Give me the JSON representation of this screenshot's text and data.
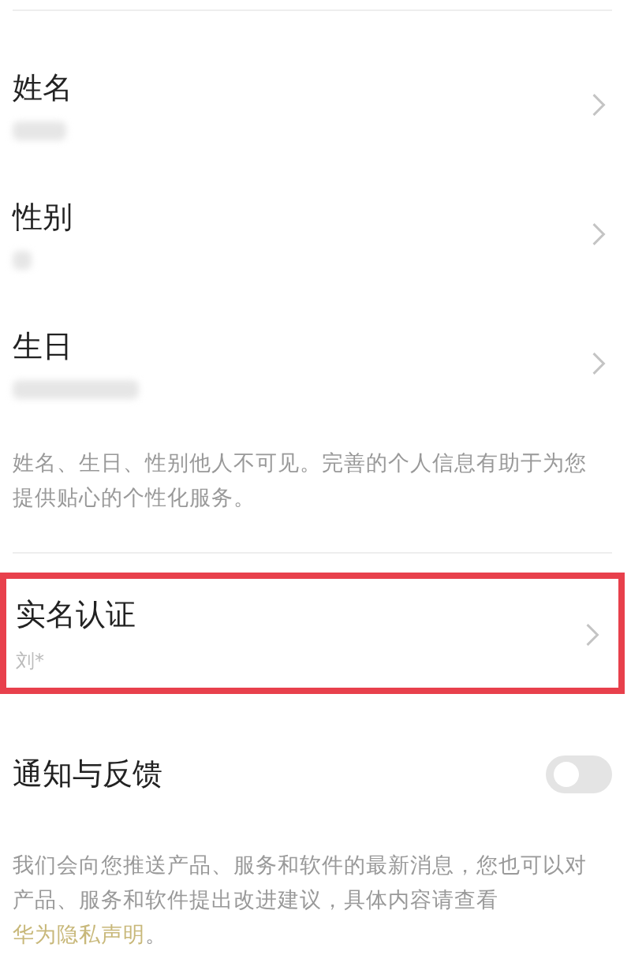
{
  "profile_items": [
    {
      "label": "姓名",
      "value_hidden": true
    },
    {
      "label": "性别",
      "value_hidden": true
    },
    {
      "label": "生日",
      "value_hidden": true
    }
  ],
  "privacy_note": "姓名、生日、性别他人不可见。完善的个人信息有助于为您提供贴心的个性化服务。",
  "verification": {
    "label": "实名认证",
    "value": "刘*",
    "highlighted": true
  },
  "notification": {
    "label": "通知与反馈",
    "on": false
  },
  "notification_note": {
    "text": "我们会向您推送产品、服务和软件的最新消息，您也可以对产品、服务和软件提出改进建议，具体内容请查看",
    "link": "华为隐私声明",
    "suffix": "。"
  }
}
